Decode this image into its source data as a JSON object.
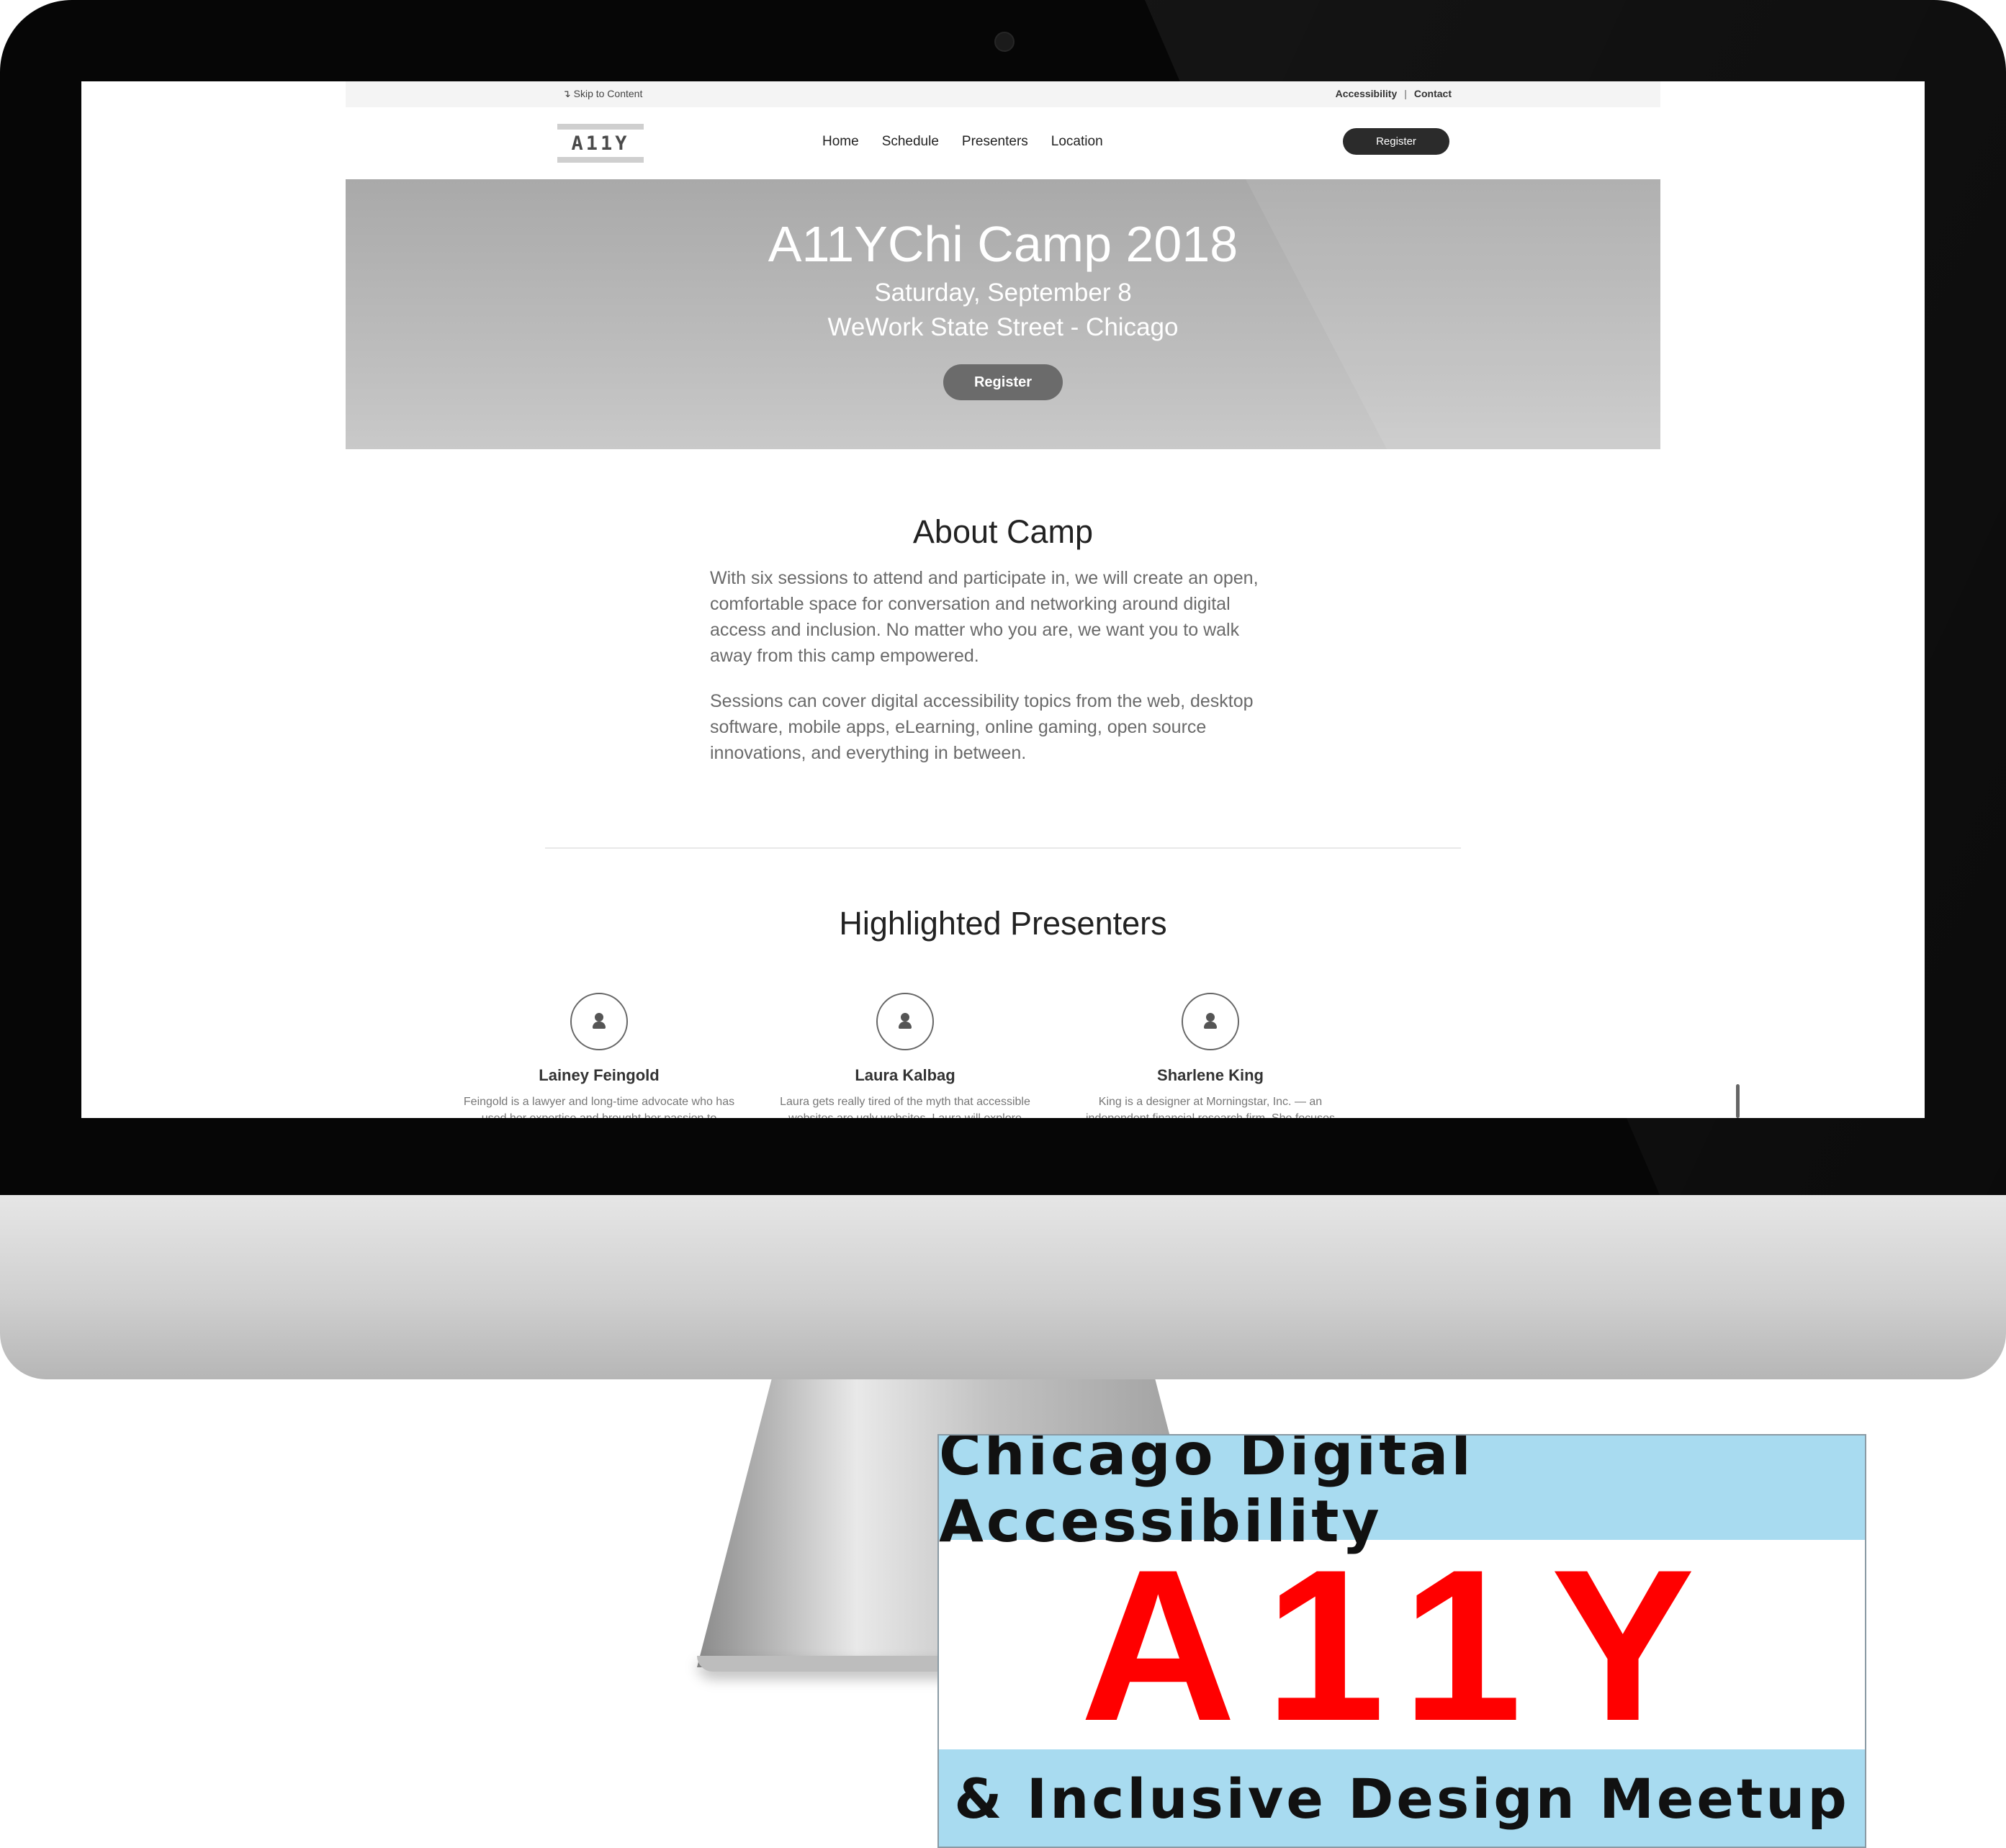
{
  "utility": {
    "skip_link": "↴ Skip to Content",
    "accessibility": "Accessibility",
    "separator": "|",
    "contact": "Contact"
  },
  "header": {
    "logo": "A11Y",
    "nav": [
      {
        "label": "Home"
      },
      {
        "label": "Schedule"
      },
      {
        "label": "Presenters"
      },
      {
        "label": "Location"
      }
    ],
    "register": "Register"
  },
  "hero": {
    "title": "A11YChi Camp 2018",
    "date": "Saturday, September 8",
    "venue": "WeWork State Street - Chicago",
    "register": "Register"
  },
  "about": {
    "title": "About Camp",
    "paragraphs": [
      "With six sessions to attend and participate in, we will create an open, comfortable space for conversation and networking around digital access and inclusion. No matter who you are, we want you to walk away from this camp empowered.",
      "Sessions can cover digital accessibility topics from the web, desktop software, mobile apps, eLearning, online gaming, open source innovations, and everything in between."
    ]
  },
  "presenters": {
    "title": "Highlighted Presenters",
    "items": [
      {
        "name": "Lainey Feingold",
        "bio": "Feingold is a lawyer and long-time advocate who has used her expertise and brought her passion to"
      },
      {
        "name": "Laura Kalbag",
        "bio": "Laura gets really tired of the myth that accessible websites are ugly websites. Laura will explore"
      },
      {
        "name": "Sharlene King",
        "bio": "King is a designer at Morningstar, Inc. — an independent financial research firm. She focuses"
      }
    ]
  },
  "meetup_logo": {
    "top": "Chicago Digital Accessibility",
    "middle": "A11Y",
    "bottom": "& Inclusive Design Meetup"
  },
  "colors": {
    "hero_text": "#ffffff",
    "logo_red": "#ff0000",
    "logo_band": "#a8dbf0",
    "button_dark": "#2b2b2b"
  },
  "icons": {
    "avatar": "user-avatar-icon"
  }
}
